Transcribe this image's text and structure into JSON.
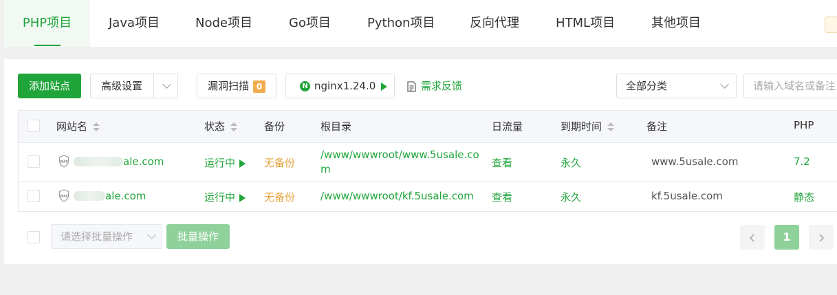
{
  "tabs": [
    {
      "label": "PHP项目",
      "active": true
    },
    {
      "label": "Java项目"
    },
    {
      "label": "Node项目"
    },
    {
      "label": "Go项目"
    },
    {
      "label": "Python项目"
    },
    {
      "label": "反向代理"
    },
    {
      "label": "HTML项目"
    },
    {
      "label": "其他项目"
    }
  ],
  "toolbar": {
    "add_site": "添加站点",
    "advanced": "高级设置",
    "vuln_scan": "漏洞扫描",
    "vuln_count": "0",
    "nginx": "nginx1.24.0",
    "nginx_logo": "N",
    "feedback": "需求反馈",
    "category": "全部分类",
    "search_placeholder": "请输入域名或备注"
  },
  "table": {
    "headers": {
      "site": "网站名",
      "status": "状态",
      "backup": "备份",
      "root": "根目录",
      "traffic": "日流量",
      "expire": "到期时间",
      "remark": "备注",
      "php": "PHP"
    },
    "rows": [
      {
        "site": "ale.com",
        "status": "运行中",
        "backup": "无备份",
        "root_line1": "/www/wwwroot/www.5usale.co",
        "root_line2": "m",
        "traffic": "查看",
        "expire": "永久",
        "remark": "www.5usale.com",
        "php": "7.2"
      },
      {
        "site": "ale.com",
        "status": "运行中",
        "backup": "无备份",
        "root_line1": "/www/wwwroot/kf.5usale.com",
        "traffic": "查看",
        "expire": "永久",
        "remark": "kf.5usale.com",
        "php": "静态"
      }
    ]
  },
  "bottom": {
    "batch_select_placeholder": "请选择批量操作",
    "batch_button": "批量操作",
    "page_current": "1"
  },
  "colors": {
    "accent": "#20a53a",
    "warning": "#e6a23c"
  }
}
